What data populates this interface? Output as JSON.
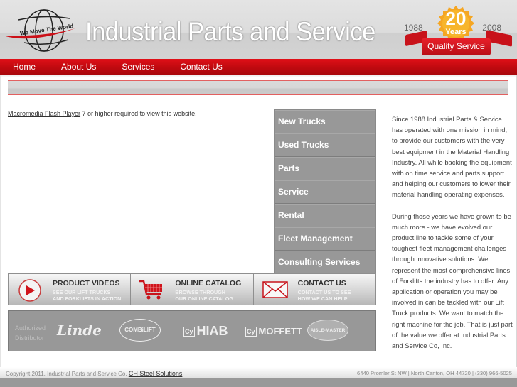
{
  "header": {
    "logo_tagline": "We Move The World",
    "site_title": "Industrial Parts and Service",
    "badge": {
      "year_start": "1988",
      "year_end": "2008",
      "number": "20",
      "unit": "Years",
      "ribbon_text": "Quality Service"
    }
  },
  "nav": {
    "items": [
      {
        "label": "Home"
      },
      {
        "label": "About Us"
      },
      {
        "label": "Services"
      },
      {
        "label": "Contact Us"
      }
    ]
  },
  "flash_notice": {
    "link_text": "Macromedia Flash Player",
    "text": " 7 or higher required to view this website."
  },
  "side_menu": {
    "items": [
      {
        "label": "New Trucks"
      },
      {
        "label": "Used Trucks"
      },
      {
        "label": "Parts"
      },
      {
        "label": "Service"
      },
      {
        "label": "Rental"
      },
      {
        "label": "Fleet Management"
      },
      {
        "label": "Consulting Services"
      }
    ]
  },
  "about": {
    "paragraphs": [
      "Since 1988 Industrial Parts & Service has operated with one mission in mind; to provide our customers with the very best equipment in the Material Handling Industry. All while backing the equipment with on time service and parts support and helping our customers to lower their material handling operating expenses.",
      "During those years we have grown to be much more - we have evolved our product line to tackle some of your toughest fleet management challenges through innovative solutions. We represent the most comprehensive lines of Forklifts the industry has to offer. Any application or operation you may be involved in can be tackled with our Lift Truck products. We want to match the right machine for the job. That is just part of the value we offer at Industrial Parts and Service Co, Inc."
    ]
  },
  "promos": [
    {
      "icon": "play-icon",
      "title": "PRODUCT VIDEOS",
      "line1": "SEE OUR LIFT TRUCKS",
      "line2": "AND FORKLIFTS IN ACTION"
    },
    {
      "icon": "shopping-cart-icon",
      "title": "ONLINE CATALOG",
      "line1": "BROWSE THROUGH",
      "line2": "OUR ONLINE CATALOG"
    },
    {
      "icon": "envelope-icon",
      "title": "CONTACT US",
      "line1": "CONTACT US TO SEE",
      "line2": "HOW WE CAN HELP"
    }
  ],
  "distributor": {
    "label_line1": "Authorized",
    "label_line2": "Distributor",
    "brands": {
      "linde": "Linde",
      "combilift": "COMBiLIFT",
      "hiab": "HIAB",
      "moffett": "MOFFETT",
      "aislemaster": "AISLE-MASTER",
      "cy_mark": "Cy"
    }
  },
  "footer": {
    "copyright": "Copyright 2011, Industrial Parts and Service Co. ",
    "credit_link": "CH Steel Solutions",
    "address": "6440 Promler St NW | North Canton, OH 44720 | (330) 966-5025"
  },
  "colors": {
    "nav_red": "#c20a10",
    "menu_gray": "#989898",
    "badge_orange": "#f5a623"
  }
}
